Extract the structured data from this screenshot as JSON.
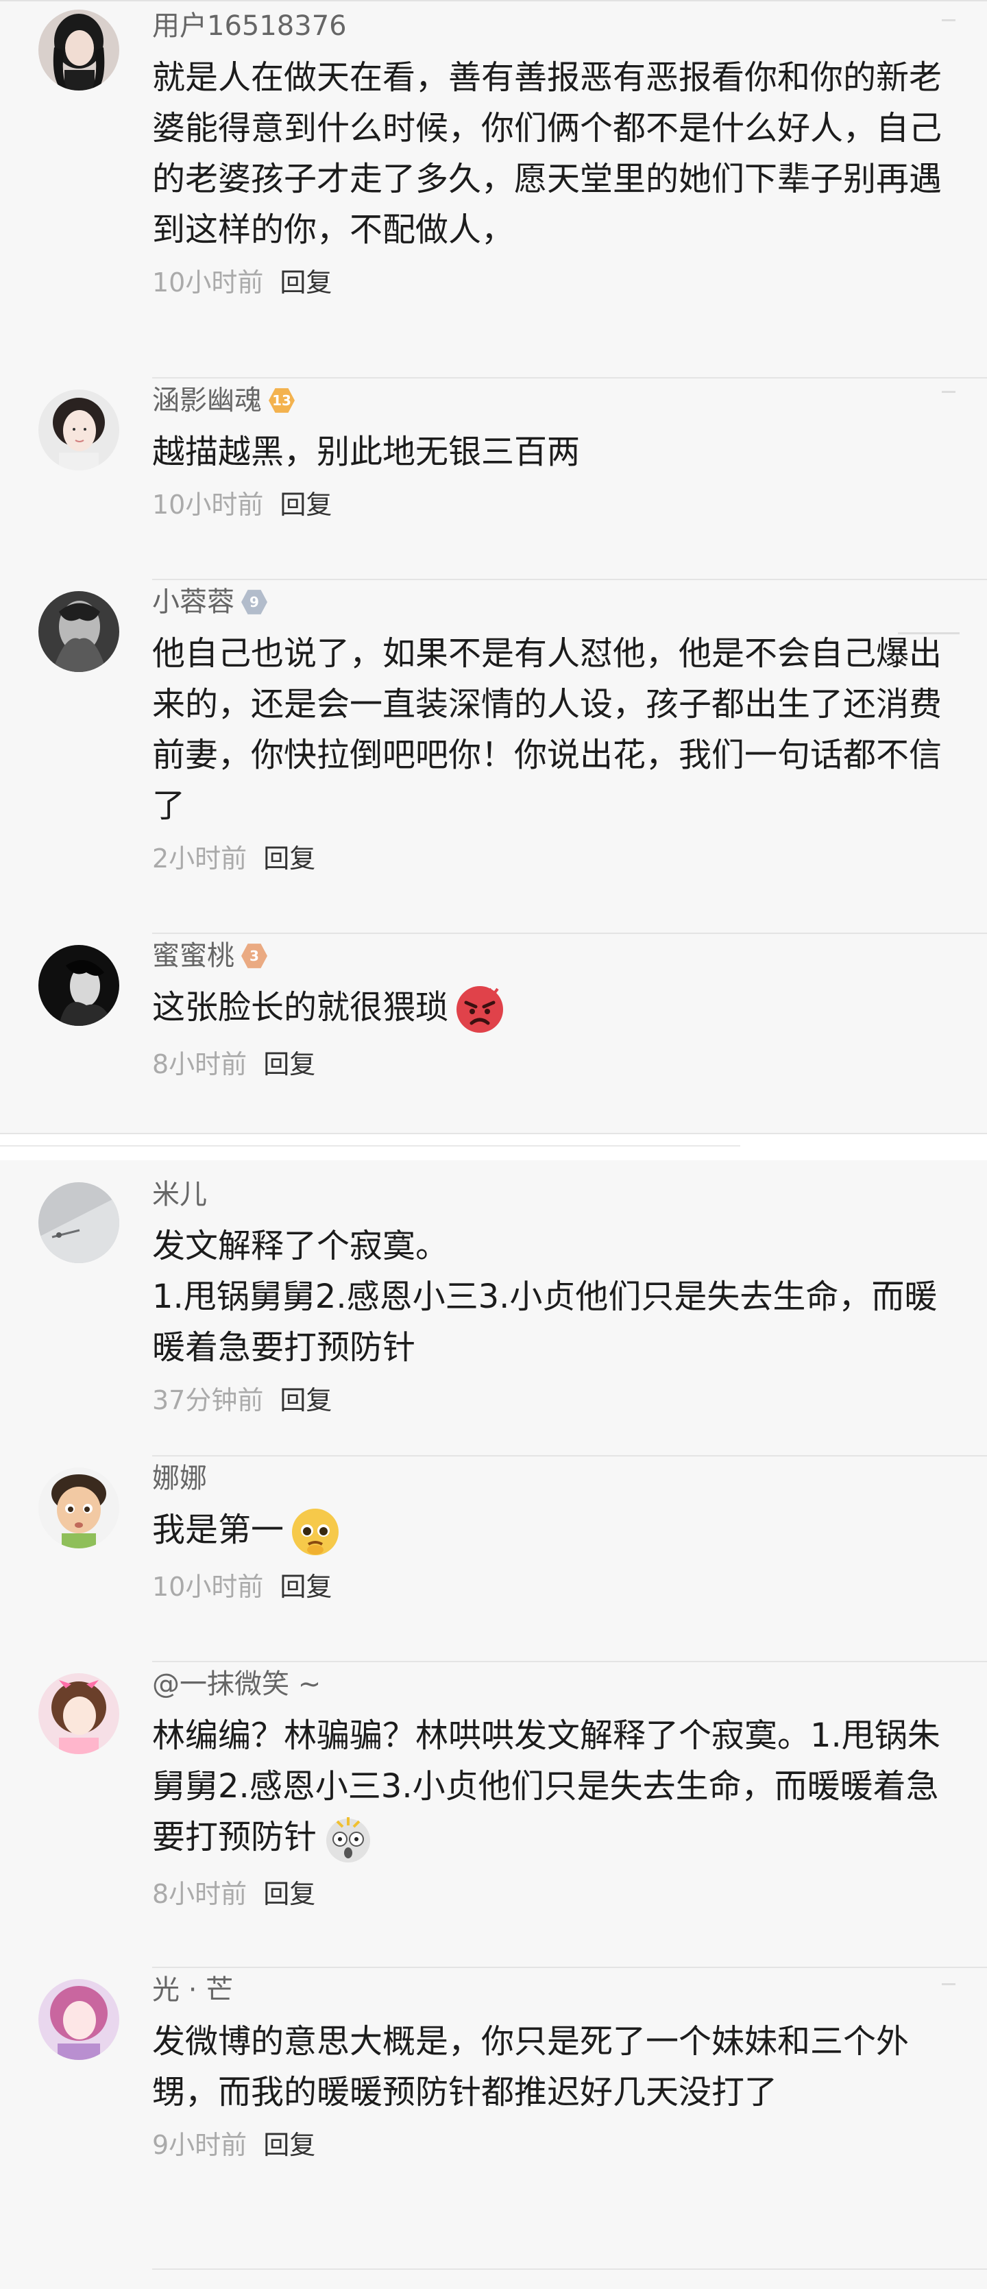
{
  "group_one": [
    {
      "name": "用户16518376",
      "level": "",
      "text": "就是人在做天在看，善有善报恶有恶报看你和你的新老婆能得意到什么时候，你们俩个都不是什么好人，自己的老婆孩子才走了多久，愿天堂里的她们下辈子别再遇到这样的你，不配做人，",
      "time": "10小时前",
      "reply": "回复"
    },
    {
      "name": "涵影幽魂",
      "level": "13",
      "text": "越描越黑，别此地无银三百两",
      "time": "10小时前",
      "reply": "回复"
    },
    {
      "name": "小蓉蓉",
      "level": "9",
      "text": "他自己也说了，如果不是有人怼他，他是不会自己爆出来的，还是会一直装深情的人设，孩子都出生了还消费前妻，你快拉倒吧吧你！你说出花，我们一句话都不信了",
      "time": "2小时前",
      "reply": "回复"
    },
    {
      "name": "蜜蜜桃",
      "level": "3",
      "text": "这张脸长的就很猥琐",
      "time": "8小时前",
      "reply": "回复",
      "emoji": "angry-face"
    }
  ],
  "group_two": [
    {
      "name": "米儿",
      "text_lines": [
        "发文解释了个寂寞。",
        "1.甩锅舅舅2.感恩小三3.小贞他们只是失去生命，而暖暖着急要打预防针"
      ],
      "time": "37分钟前",
      "reply": "回复"
    },
    {
      "name": "娜娜",
      "text": "我是第一",
      "time": "10小时前",
      "reply": "回复",
      "emoji": "pleading-face"
    },
    {
      "name": "@一抹微笑 ~",
      "text": "林编编？林骗骗？林哄哄发文解释了个寂寞。1.甩锅朱舅舅2.感恩小三3.小贞他们只是失去生命，而暖暖着急要打预防针",
      "time": "8小时前",
      "reply": "回复",
      "emoji": "shocked-face"
    },
    {
      "name": "光 · 芒",
      "text": "发微博的意思大概是，你只是死了一个妹妹和三个外甥，而我的暖暖预防针都推迟好几天没打了",
      "time": "9小时前",
      "reply": "回复"
    }
  ]
}
